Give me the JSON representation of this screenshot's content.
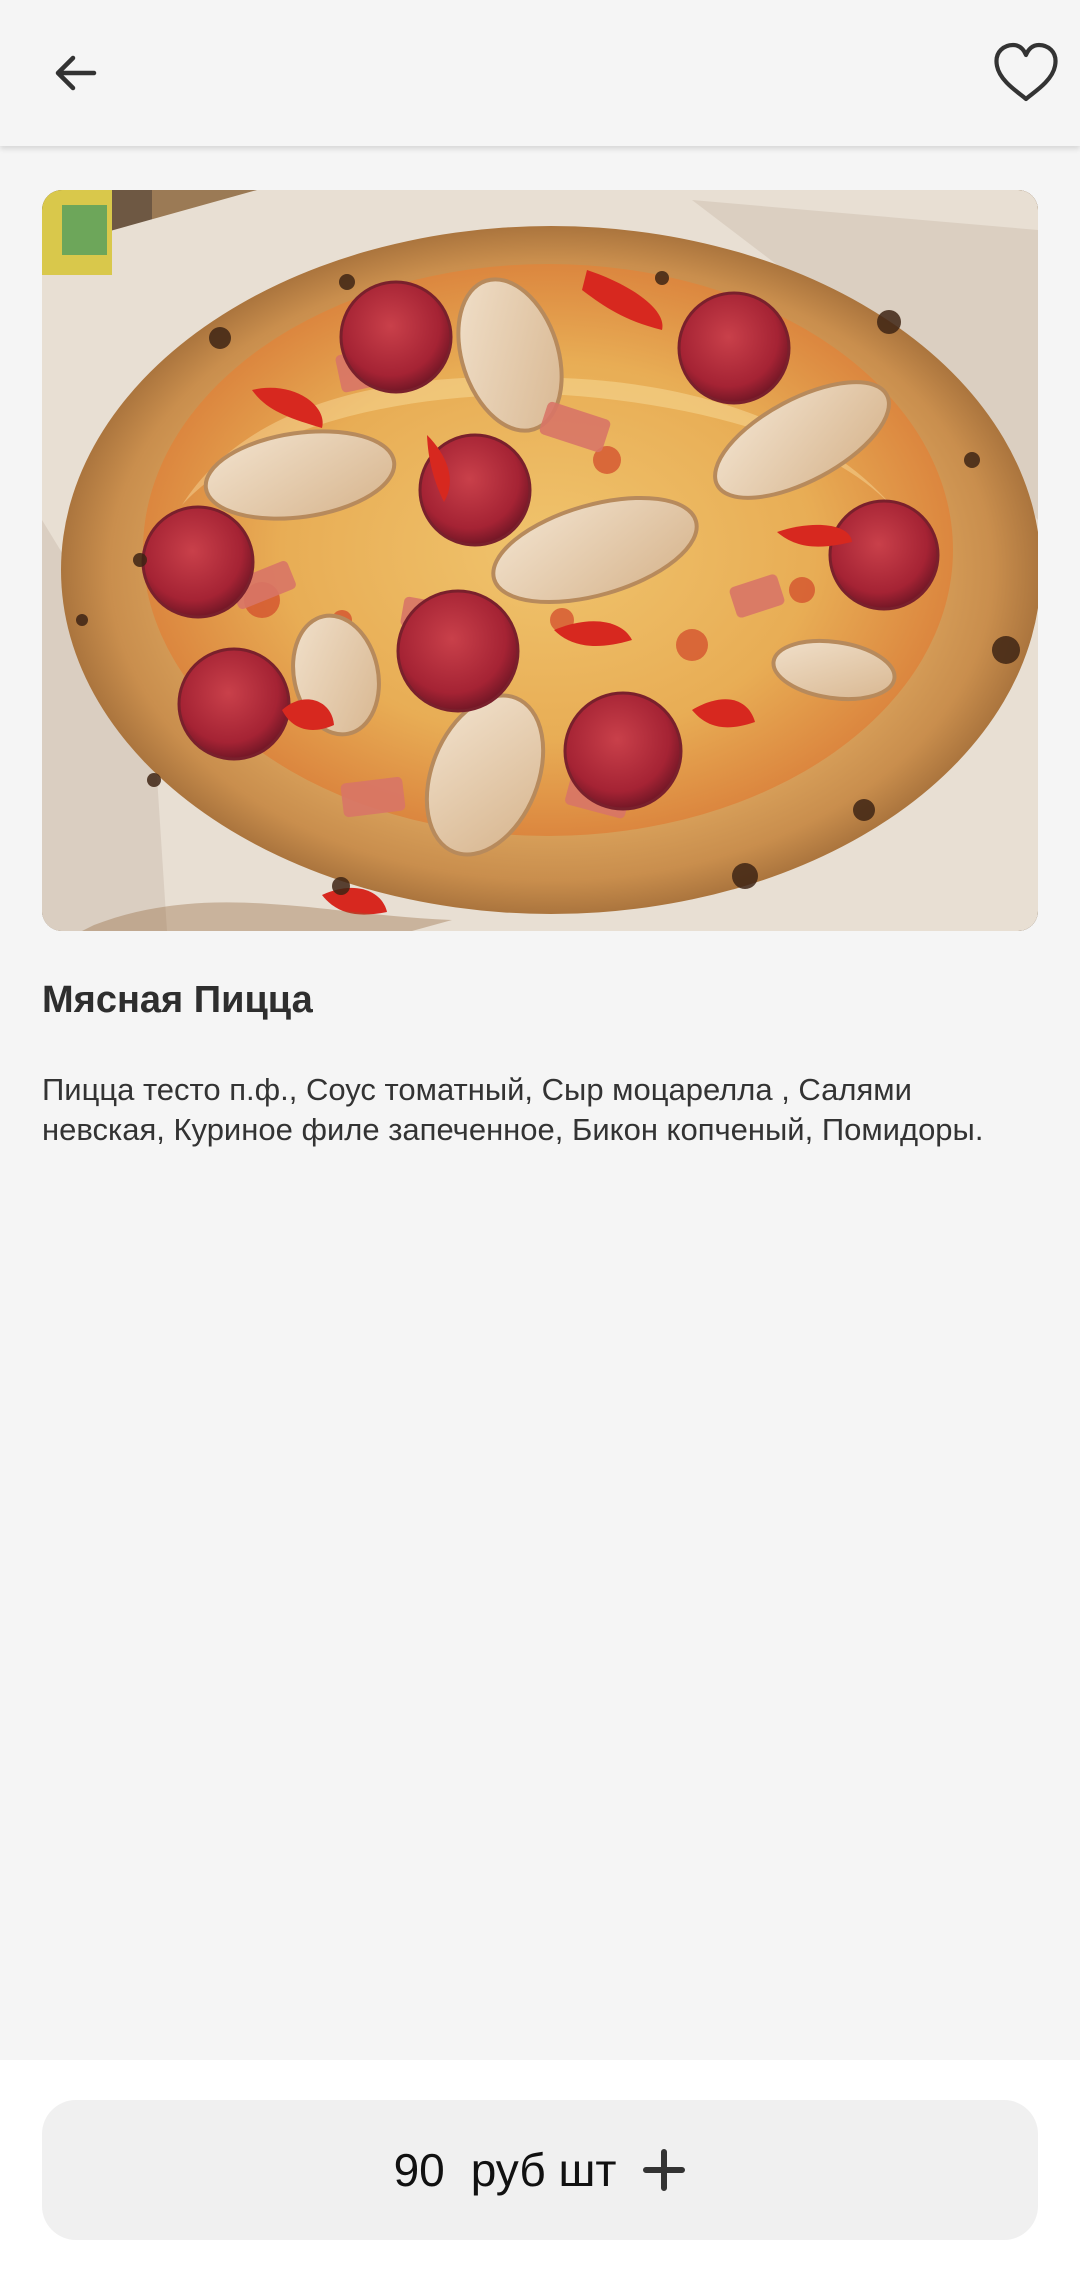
{
  "header": {
    "back_icon": "arrow-left-icon",
    "favorite_icon": "heart-outline-icon"
  },
  "product": {
    "image_alt": "Мясная Пицца",
    "title": "Мясная Пицца",
    "description": "Пицца тесто п.ф., Соус томатный, Сыр моцарелла , Салями невская, Куриное филе запеченное, Бикон копченый, Помидоры."
  },
  "purchase": {
    "price": "90",
    "unit": "руб шт",
    "add_icon": "plus-icon"
  },
  "colors": {
    "background": "#f5f5f5",
    "button_background": "#f0f0f0",
    "text": "#2f2f2f"
  }
}
